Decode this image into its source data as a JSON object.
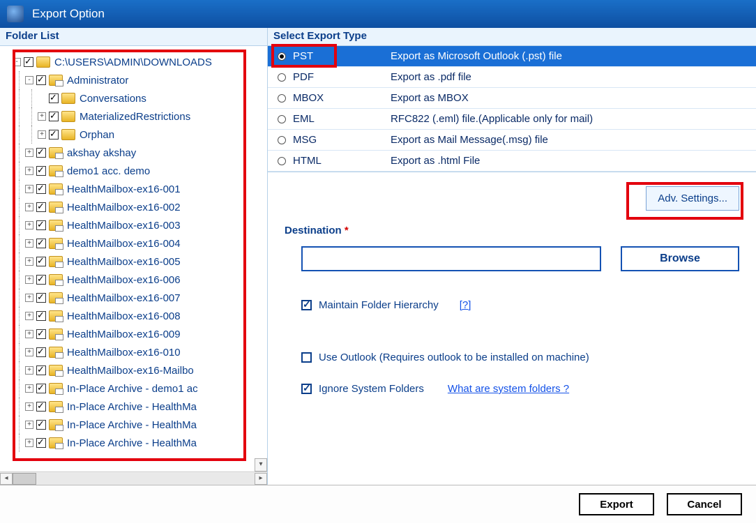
{
  "window": {
    "title": "Export Option"
  },
  "left": {
    "header": "Folder List",
    "tree": [
      {
        "depth": 0,
        "expander": "-",
        "checked": true,
        "icon": "folder",
        "label": "C:\\USERS\\ADMIN\\DOWNLOADS"
      },
      {
        "depth": 1,
        "expander": "-",
        "checked": true,
        "icon": "mail",
        "label": "Administrator"
      },
      {
        "depth": 2,
        "expander": "",
        "checked": true,
        "icon": "folder",
        "label": "Conversations"
      },
      {
        "depth": 2,
        "expander": "+",
        "checked": true,
        "icon": "folder",
        "label": "MaterializedRestrictions"
      },
      {
        "depth": 2,
        "expander": "+",
        "checked": true,
        "icon": "folder",
        "label": "Orphan"
      },
      {
        "depth": 1,
        "expander": "+",
        "checked": true,
        "icon": "mail",
        "label": "akshay akshay"
      },
      {
        "depth": 1,
        "expander": "+",
        "checked": true,
        "icon": "mail",
        "label": "demo1 acc. demo"
      },
      {
        "depth": 1,
        "expander": "+",
        "checked": true,
        "icon": "mail",
        "label": "HealthMailbox-ex16-001"
      },
      {
        "depth": 1,
        "expander": "+",
        "checked": true,
        "icon": "mail",
        "label": "HealthMailbox-ex16-002"
      },
      {
        "depth": 1,
        "expander": "+",
        "checked": true,
        "icon": "mail",
        "label": "HealthMailbox-ex16-003"
      },
      {
        "depth": 1,
        "expander": "+",
        "checked": true,
        "icon": "mail",
        "label": "HealthMailbox-ex16-004"
      },
      {
        "depth": 1,
        "expander": "+",
        "checked": true,
        "icon": "mail",
        "label": "HealthMailbox-ex16-005"
      },
      {
        "depth": 1,
        "expander": "+",
        "checked": true,
        "icon": "mail",
        "label": "HealthMailbox-ex16-006"
      },
      {
        "depth": 1,
        "expander": "+",
        "checked": true,
        "icon": "mail",
        "label": "HealthMailbox-ex16-007"
      },
      {
        "depth": 1,
        "expander": "+",
        "checked": true,
        "icon": "mail",
        "label": "HealthMailbox-ex16-008"
      },
      {
        "depth": 1,
        "expander": "+",
        "checked": true,
        "icon": "mail",
        "label": "HealthMailbox-ex16-009"
      },
      {
        "depth": 1,
        "expander": "+",
        "checked": true,
        "icon": "mail",
        "label": "HealthMailbox-ex16-010"
      },
      {
        "depth": 1,
        "expander": "+",
        "checked": true,
        "icon": "mail",
        "label": "HealthMailbox-ex16-Mailbo"
      },
      {
        "depth": 1,
        "expander": "+",
        "checked": true,
        "icon": "mail",
        "label": "In-Place Archive - demo1 ac"
      },
      {
        "depth": 1,
        "expander": "+",
        "checked": true,
        "icon": "mail",
        "label": "In-Place Archive - HealthMa"
      },
      {
        "depth": 1,
        "expander": "+",
        "checked": true,
        "icon": "mail",
        "label": "In-Place Archive - HealthMa"
      },
      {
        "depth": 1,
        "expander": "+",
        "checked": true,
        "icon": "mail",
        "label": "In-Place Archive - HealthMa"
      }
    ]
  },
  "right": {
    "header": "Select Export Type",
    "types": [
      {
        "code": "PST",
        "desc": "Export as Microsoft Outlook (.pst) file",
        "selected": true
      },
      {
        "code": "PDF",
        "desc": "Export as .pdf file",
        "selected": false
      },
      {
        "code": "MBOX",
        "desc": "Export as MBOX",
        "selected": false
      },
      {
        "code": "EML",
        "desc": "RFC822 (.eml) file.(Applicable only for mail)",
        "selected": false
      },
      {
        "code": "MSG",
        "desc": "Export as Mail Message(.msg) file",
        "selected": false
      },
      {
        "code": "HTML",
        "desc": "Export as .html File",
        "selected": false
      }
    ],
    "adv_button": "Adv. Settings...",
    "destination_label": "Destination",
    "required_mark": "*",
    "destination_value": "",
    "browse_button": "Browse",
    "options": {
      "maintain_hierarchy": {
        "label": "Maintain Folder Hierarchy",
        "checked": true,
        "help": "[?]"
      },
      "use_outlook": {
        "label": "Use Outlook (Requires outlook to be installed on machine)",
        "checked": false
      },
      "ignore_system": {
        "label": "Ignore System Folders",
        "checked": true,
        "help": "What are system folders ?"
      }
    }
  },
  "footer": {
    "export": "Export",
    "cancel": "Cancel"
  }
}
